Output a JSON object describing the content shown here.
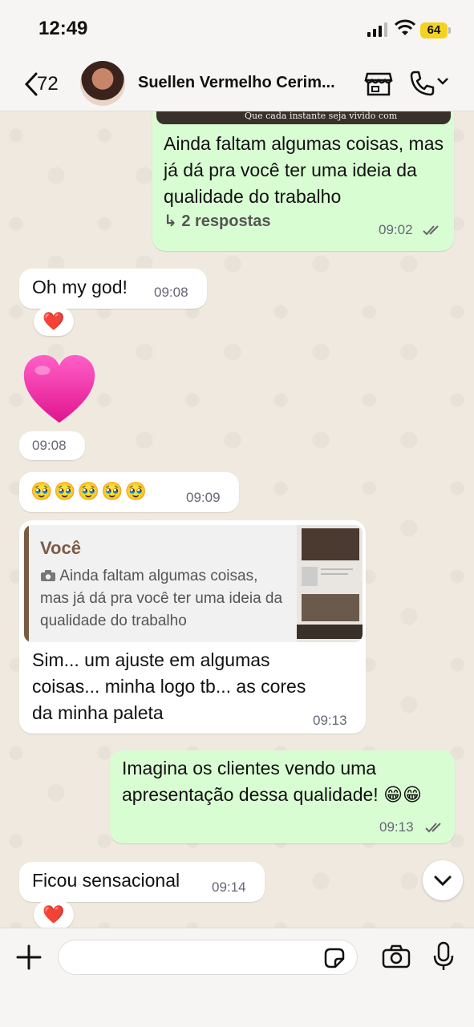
{
  "status_bar": {
    "time": "12:49",
    "battery": "64"
  },
  "header": {
    "back_count": "72",
    "contact_name": "Suellen Vermelho Cerim..."
  },
  "messages": [
    {
      "image_caption": "Que cada instante seja vivido com",
      "text": "Ainda faltam algumas coisas, mas já dá pra você ter uma ideia da qualidade do trabalho",
      "replies": "2 respostas",
      "time": "09:02"
    },
    {
      "text": "Oh my god!",
      "time": "09:08",
      "reaction": "❤️"
    },
    {
      "emoji": "💗",
      "time": "09:08"
    },
    {
      "text": "🥹🥹🥹🥹🥹",
      "time": "09:09"
    },
    {
      "quote_author": "Você",
      "quote_text": "Ainda faltam algumas coisas, mas já dá pra você ter uma ideia da qualidade do trabalho",
      "text": "Sim... um ajuste em algumas coisas... minha logo tb... as cores da minha paleta",
      "time": "09:13"
    },
    {
      "text": "Imagina os clientes vendo uma apresentação dessa qualidade! 😁😁",
      "time": "09:13"
    },
    {
      "text": "Ficou sensacional",
      "time": "09:14",
      "reaction": "❤️"
    }
  ],
  "composer": {
    "placeholder": ""
  }
}
